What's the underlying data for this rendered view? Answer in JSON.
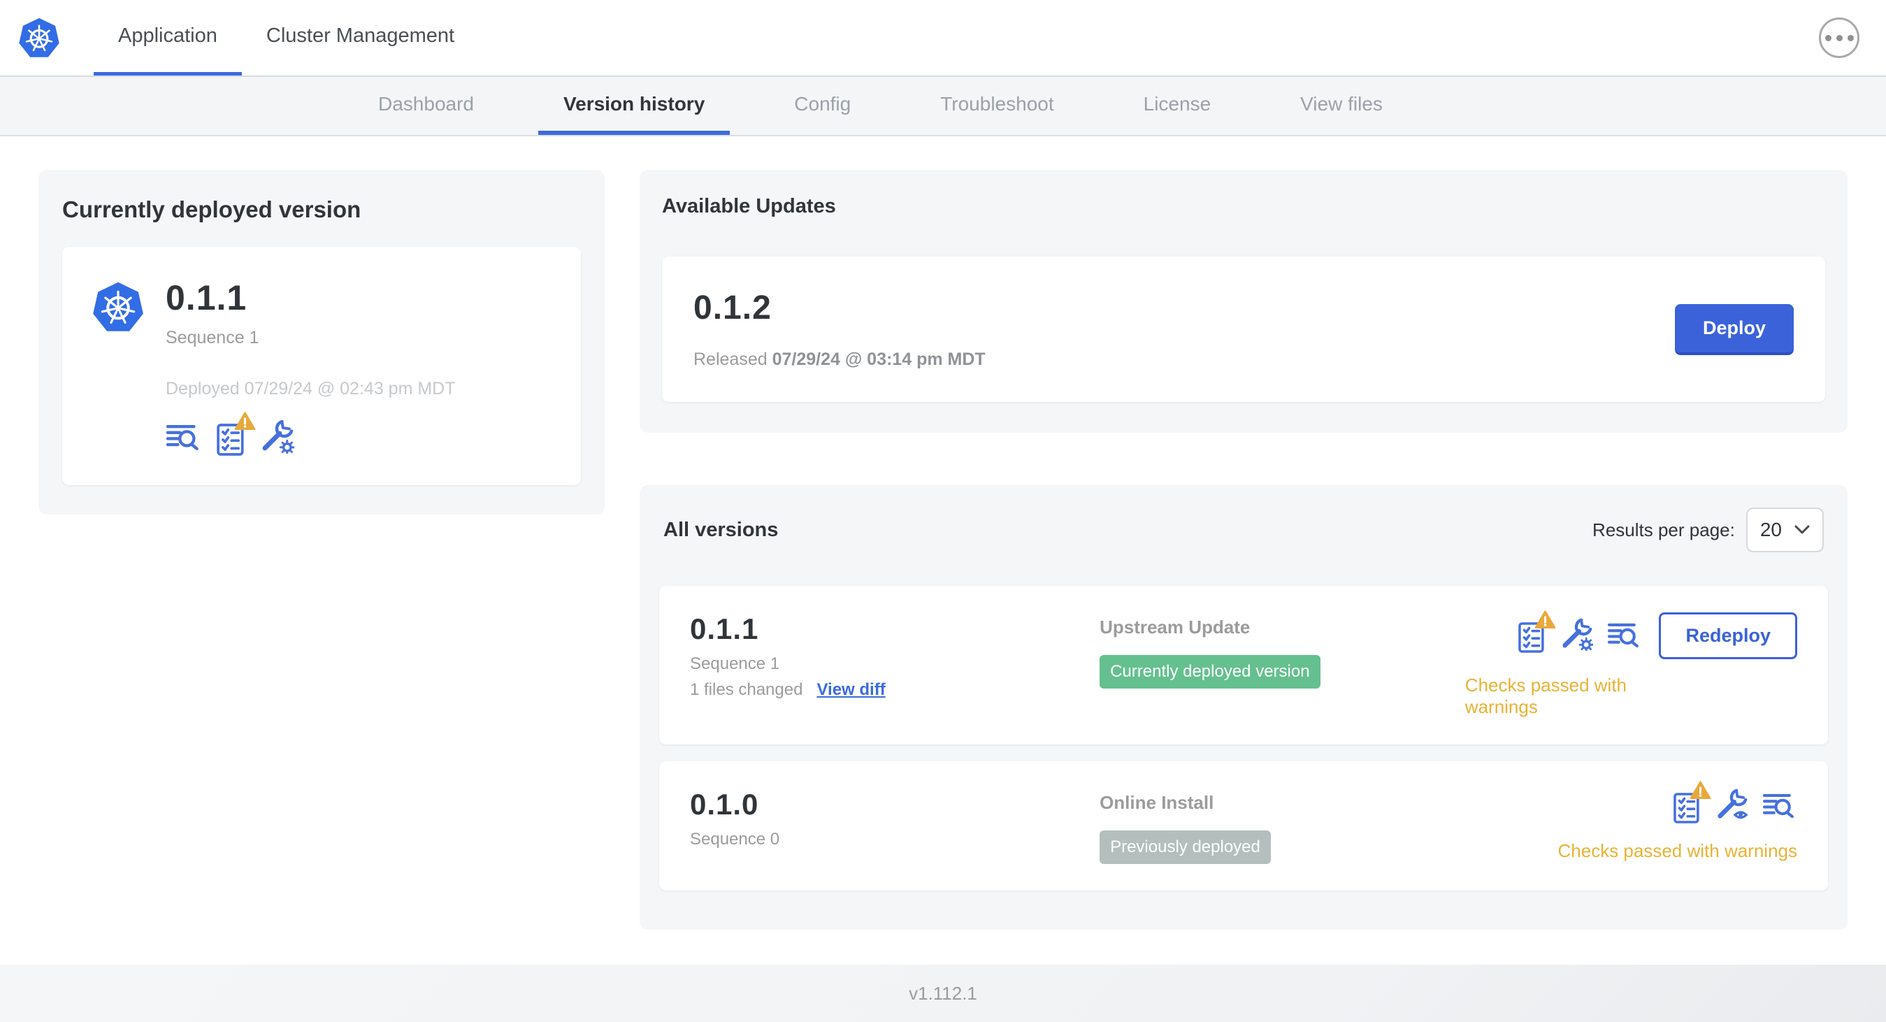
{
  "header": {
    "tabs": [
      {
        "label": "Application",
        "active": true
      },
      {
        "label": "Cluster Management",
        "active": false
      }
    ]
  },
  "subnav": {
    "tabs": [
      {
        "label": "Dashboard",
        "active": false
      },
      {
        "label": "Version history",
        "active": true
      },
      {
        "label": "Config",
        "active": false
      },
      {
        "label": "Troubleshoot",
        "active": false
      },
      {
        "label": "License",
        "active": false
      },
      {
        "label": "View files",
        "active": false
      }
    ]
  },
  "deployed_card": {
    "title": "Currently deployed version",
    "version": "0.1.1",
    "sequence": "Sequence 1",
    "deployed_at": "Deployed 07/29/24 @ 02:43 pm MDT"
  },
  "available_updates": {
    "title": "Available Updates",
    "version": "0.1.2",
    "released_prefix": "Released",
    "released_date": "07/29/24 @ 03:14 pm MDT",
    "deploy_label": "Deploy"
  },
  "all_versions": {
    "title": "All versions",
    "results_per_page_label": "Results per page:",
    "results_per_page_value": "20",
    "rows": [
      {
        "version": "0.1.1",
        "sequence": "Sequence 1",
        "files_changed": "1 files changed",
        "view_diff_label": "View diff",
        "source": "Upstream Update",
        "badge": "Currently deployed version",
        "checks_text": "Checks passed with warnings",
        "action_label": "Redeploy"
      },
      {
        "version": "0.1.0",
        "sequence": "Sequence 0",
        "source": "Online Install",
        "badge": "Previously deployed",
        "checks_text": "Checks passed with warnings"
      }
    ]
  },
  "footer": {
    "app_version": "v1.112.1"
  },
  "icons": {
    "logo": "kubernetes-helm-wheel",
    "menu": "ellipsis-in-circle",
    "release_notes": "text-lines-with-magnifier",
    "preflight_checks": "checklist-with-warning-triangle",
    "edit_config": "wrench-with-gear",
    "view_config": "wrench-with-eye",
    "dropdown": "chevron-down"
  },
  "colors": {
    "accent_blue": "#3b6bde",
    "button_blue": "#3b62d9",
    "kubernetes_blue": "#326de6",
    "icon_blue": "#4670dd",
    "warning_amber": "#e9b234",
    "warning_triangle": "#e8a93a",
    "badge_green": "#65c08f",
    "badge_gray": "#b4bfbd",
    "card_gray": "#f5f6f8"
  }
}
